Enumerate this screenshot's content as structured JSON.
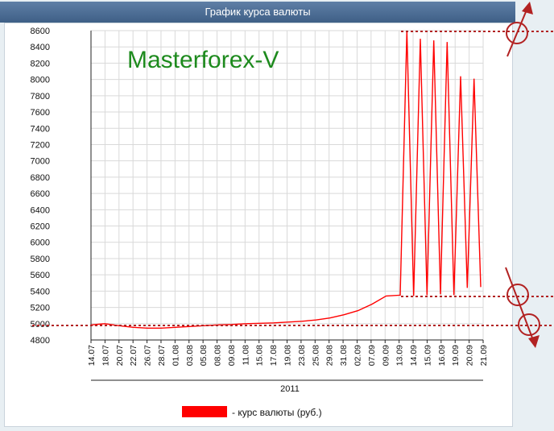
{
  "window": {
    "title": "График курса валюты"
  },
  "watermark": "Masterforex-V",
  "chart_data": {
    "type": "line",
    "title": "График курса валюты",
    "xlabel": "2011",
    "ylabel": "",
    "ylim": [
      4800,
      8600
    ],
    "yticks": [
      4800,
      5000,
      5200,
      5400,
      5600,
      5800,
      6000,
      6200,
      6400,
      6600,
      6800,
      7000,
      7200,
      7400,
      7600,
      7800,
      8000,
      8200,
      8400,
      8600
    ],
    "grid": true,
    "legend_position": "bottom",
    "categories": [
      "14.07",
      "18.07",
      "20.07",
      "22.07",
      "26.07",
      "28.07",
      "01.08",
      "03.08",
      "05.08",
      "08.08",
      "09.08",
      "11.08",
      "15.08",
      "17.08",
      "19.08",
      "23.08",
      "25.08",
      "29.08",
      "31.08",
      "02.09",
      "07.09",
      "09.09",
      "13.09",
      "14.09",
      "15.09",
      "16.09",
      "19.09",
      "20.09",
      "21.09"
    ],
    "series": [
      {
        "name": "- курс валюты (руб.)",
        "color": "#ff0000",
        "values": [
          4985,
          5000,
          4975,
          4955,
          4945,
          4945,
          4955,
          4965,
          4975,
          4985,
          4990,
          5000,
          5005,
          5010,
          5020,
          5030,
          5045,
          5070,
          5110,
          5160,
          5240,
          5340,
          5350,
          8600,
          5340,
          8500,
          5350,
          8480,
          5360,
          8460,
          5350,
          8040,
          5440,
          8010,
          5450
        ]
      }
    ]
  },
  "annotations": {
    "line_color": "#b22222",
    "arrow_color": "#b22222"
  },
  "legend": {
    "label": "- курс валюты (руб.)",
    "swatch_color": "#ff0000"
  }
}
